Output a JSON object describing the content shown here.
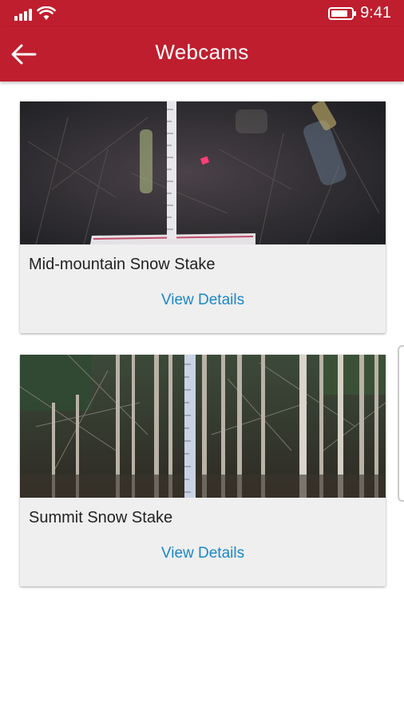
{
  "status_bar": {
    "time": "9:41",
    "battery_level": 0.85,
    "icons": [
      "signal-icon",
      "wifi-icon",
      "battery-icon"
    ]
  },
  "app_bar": {
    "title": "Webcams",
    "back_icon": "arrow-left-icon"
  },
  "webcams": [
    {
      "title": "Mid-mountain Snow Stake",
      "action_label": "View Details"
    },
    {
      "title": "Summit Snow Stake",
      "action_label": "View Details"
    }
  ],
  "colors": {
    "brand_red": "#bf1e2e",
    "link_blue": "#1b87c9",
    "card_bg": "#efefef"
  }
}
